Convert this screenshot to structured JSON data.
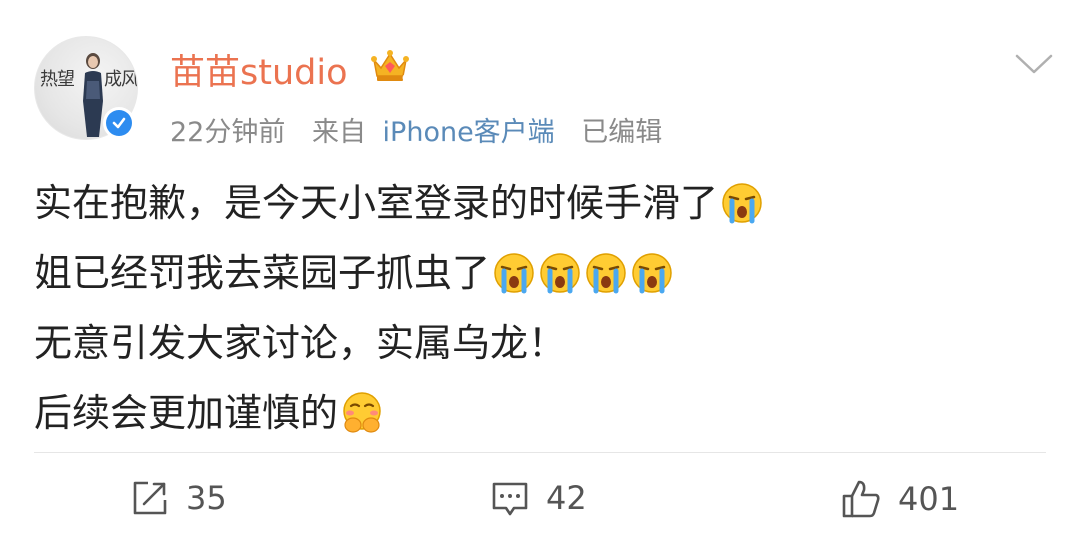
{
  "post": {
    "username": "苗苗studio",
    "time": "22分钟前",
    "source_prefix": "来自",
    "source": "iPhone客户端",
    "edited": "已编辑",
    "avatar_text_left": "热望",
    "avatar_text_right": "成风",
    "lines": [
      "实在抱歉，是今天小室登录的时候手滑了",
      "姐已经罚我去菜园子抓虫了",
      "无意引发大家讨论，实属乌龙！",
      "后续会更加谨慎的"
    ]
  },
  "actions": {
    "repost_count": "35",
    "comment_count": "42",
    "like_count": "401"
  },
  "icons": {
    "verify": "verified-badge-icon",
    "crown": "vip-crown-icon",
    "menu": "chevron-down-icon",
    "crying": "crying-emoji-icon",
    "shy": "shy-emoji-icon",
    "repost": "repost-icon",
    "comment": "comment-icon",
    "like": "like-icon"
  },
  "colors": {
    "username": "#eb7350",
    "meta": "#8a8a8a",
    "verify": "#2d8cf0"
  }
}
